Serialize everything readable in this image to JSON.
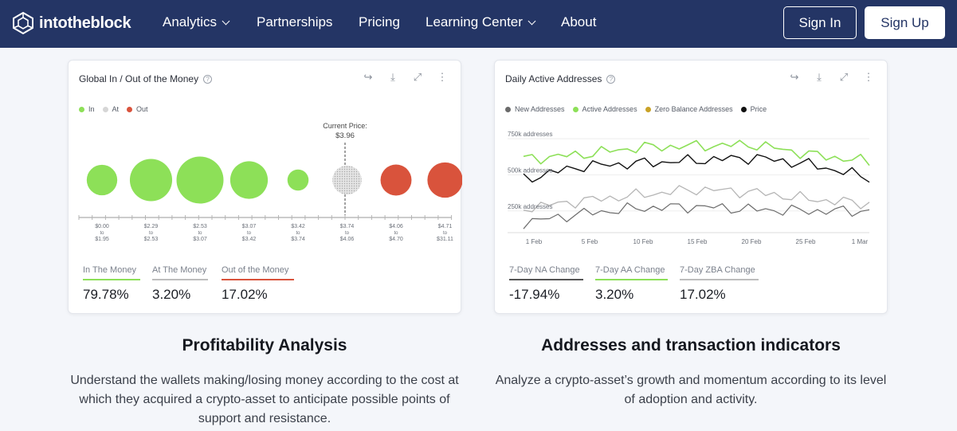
{
  "nav": {
    "brand": "intotheblock",
    "links": [
      {
        "label": "Analytics",
        "dropdown": true
      },
      {
        "label": "Partnerships",
        "dropdown": false
      },
      {
        "label": "Pricing",
        "dropdown": false
      },
      {
        "label": "Learning Center",
        "dropdown": true
      },
      {
        "label": "About",
        "dropdown": false
      }
    ],
    "sign_in": "Sign In",
    "sign_up": "Sign Up"
  },
  "colors": {
    "nav_bg": "#243565",
    "in": "#8de058",
    "at": "#cfcfcf",
    "out": "#d9533c"
  },
  "left_card": {
    "title": "Global In / Out of the Money",
    "legend": [
      "In",
      "At",
      "Out"
    ],
    "current_price_label": "Current Price:",
    "current_price": "$3.96",
    "bubbles": [
      {
        "range": [
          "$0.00",
          "to",
          "$1.95"
        ],
        "status": "in"
      },
      {
        "range": [
          "$2.29",
          "to",
          "$2.53"
        ],
        "status": "in"
      },
      {
        "range": [
          "$2.53",
          "to",
          "$3.07"
        ],
        "status": "in"
      },
      {
        "range": [
          "$3.07",
          "to",
          "$3.42"
        ],
        "status": "in"
      },
      {
        "range": [
          "$3.42",
          "to",
          "$3.74"
        ],
        "status": "in"
      },
      {
        "range": [
          "$3.74",
          "to",
          "$4.06"
        ],
        "status": "at"
      },
      {
        "range": [
          "$4.06",
          "to",
          "$4.70"
        ],
        "status": "out"
      },
      {
        "range": [
          "$4.71",
          "to",
          "$31.11"
        ],
        "status": "out"
      }
    ],
    "stats": [
      {
        "label": "In The Money",
        "value": "79.78%",
        "color": "#8de058"
      },
      {
        "label": "At The Money",
        "value": "3.20%",
        "color": "#bdbdbd"
      },
      {
        "label": "Out of the Money",
        "value": "17.02%",
        "color": "#d9533c"
      }
    ]
  },
  "right_card": {
    "title": "Daily Active Addresses",
    "legend": [
      {
        "label": "New Addresses",
        "color": "#6b6b6b"
      },
      {
        "label": "Active Addresses",
        "color": "#8de058"
      },
      {
        "label": "Zero Balance Addresses",
        "color": "#c9a227"
      },
      {
        "label": "Price",
        "color": "#111111"
      }
    ],
    "y_ticks": [
      "750k addresses",
      "500k addresses",
      "250k addresses"
    ],
    "x_ticks": [
      "1 Feb",
      "5 Feb",
      "10 Feb",
      "15 Feb",
      "20 Feb",
      "25 Feb",
      "1 Mar"
    ],
    "stats": [
      {
        "label": "7-Day NA Change",
        "value": "-17.94%",
        "color": "#555555"
      },
      {
        "label": "7-Day AA Change",
        "value": "3.20%",
        "color": "#8de058"
      },
      {
        "label": "7-Day ZBA Change",
        "value": "17.02%",
        "color": "#bdbdbd"
      }
    ]
  },
  "chart_data": [
    {
      "type": "scatter",
      "title": "Global In / Out of the Money",
      "categories": [
        "$0.00 to $1.95",
        "$2.29 to $2.53",
        "$2.53 to $3.07",
        "$3.07 to $3.42",
        "$3.42 to $3.74",
        "$3.74 to $4.06",
        "$4.06 to $4.70",
        "$4.71 to $31.11"
      ],
      "series": [
        {
          "name": "In",
          "values": [
            0.65,
            0.9,
            1.0,
            0.8,
            0.45,
            null,
            null,
            null
          ]
        },
        {
          "name": "At",
          "values": [
            null,
            null,
            null,
            null,
            null,
            0.62,
            null,
            null
          ]
        },
        {
          "name": "Out",
          "values": [
            null,
            null,
            null,
            null,
            null,
            null,
            0.66,
            0.75
          ]
        }
      ],
      "legend": "top-left"
    },
    {
      "type": "line",
      "title": "Daily Active Addresses",
      "x": [
        "1 Feb",
        "5 Feb",
        "10 Feb",
        "15 Feb",
        "20 Feb",
        "25 Feb",
        "1 Mar"
      ],
      "series": [
        {
          "name": "Active Addresses",
          "values": [
            610000,
            640000,
            690000,
            700000,
            710000,
            640000,
            590000
          ]
        },
        {
          "name": "Price",
          "values": [
            470000,
            560000,
            580000,
            600000,
            620000,
            570000,
            480000
          ]
        },
        {
          "name": "Zero Balance Addresses",
          "values": [
            270000,
            320000,
            360000,
            400000,
            380000,
            330000,
            300000
          ]
        },
        {
          "name": "New Addresses",
          "values": [
            170000,
            230000,
            270000,
            280000,
            260000,
            250000,
            250000
          ]
        }
      ],
      "ylabel": "addresses",
      "ylim": [
        100000,
        850000
      ],
      "legend": "top-left"
    }
  ],
  "sections": [
    {
      "title": "Profitability Analysis",
      "description": "Understand the wallets making/losing money according to the cost at which they acquired a crypto-asset to anticipate possible points of support and resistance."
    },
    {
      "title": "Addresses and transaction indicators",
      "description": "Analyze a crypto-asset’s growth and momentum according to its level of adoption and activity."
    }
  ]
}
